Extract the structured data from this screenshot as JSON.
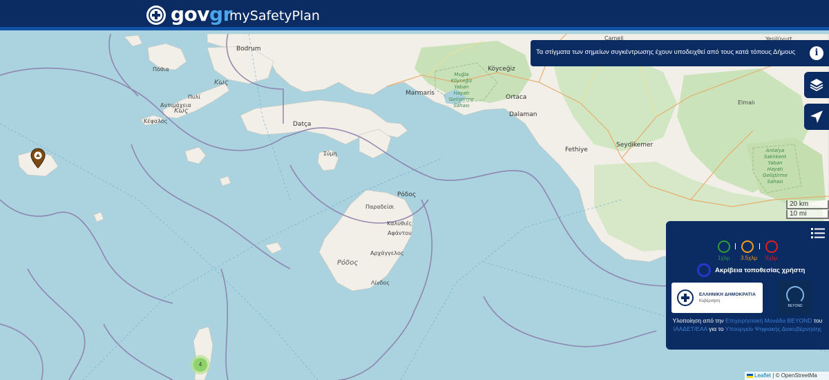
{
  "header": {
    "logo_gov": "gov",
    "logo_gr": "gr",
    "app_title": "mySafetyPlan"
  },
  "info_banner": {
    "text": "Τα στίγματα των σημείων συγκέντρωσης έχουν υποδειχθεί από τους κατά τόπους Δήμους",
    "icon": "info-icon"
  },
  "controls": {
    "layers_icon": "layers-icon",
    "locate_icon": "navigation-arrow-icon",
    "legend_toggle_icon": "list-icon"
  },
  "scale": {
    "km": "20 km",
    "mi": "10 mi"
  },
  "legend": {
    "radii": [
      {
        "label": "1χλμ",
        "color": "#2e9a3c"
      },
      {
        "label": "3.5χλμ",
        "color": "#f0a020"
      },
      {
        "label": "5χλμ",
        "color": "#e02020"
      }
    ],
    "accuracy_label": "Ακρίβεια τοποθεσίας χρήστη",
    "accuracy_color": "#2a35c9",
    "gov_card_title": "ΕΛΛΗΝΙΚΗ ΔΗΜΟΚΡΑΤΙΑ",
    "gov_card_subtitle": "Κυβέρνηση",
    "beyond_label": "BEYOND",
    "credit_prefix": "Υλοποίηση από την",
    "credit_link1": "Επιχειρησιακή Μονάδα BEYOND",
    "credit_mid1": "του",
    "credit_link2": "IAAΔET/EAA",
    "credit_mid2": "για το",
    "credit_link3": "Υπουργείο Ψηφιακής Διακυβέρνησης"
  },
  "attribution": {
    "leaflet": "Leaflet",
    "sep": "|",
    "osm": "© OpenStreetMa"
  },
  "markers": {
    "cluster_count": "4",
    "pin_icon": "map-pin-icon"
  },
  "places": {
    "bodrum": "Bodrum",
    "pothia": "Πόθια",
    "kos_gr": "Κως",
    "pyli": "Πυλί",
    "antimacheia": "Αντιμάχεια",
    "kos_island": "Κως",
    "kefalos": "Κέφαλος",
    "datca": "Datça",
    "symi": "Σύμη",
    "rodos": "Ρόδος",
    "paradeisi": "Παραδείσι",
    "kalythies": "Καλυθιές",
    "afantou": "Αφάντου",
    "archangelos": "Αρχάγγελος",
    "rodos_island": "Ρόδος",
    "lindos": "Λίνδος",
    "marmaris": "Marmaris",
    "koycegiz": "Köyceğiz",
    "ortaca": "Ortaca",
    "dalaman": "Dalaman",
    "fethiye": "Fethiye",
    "seydikemer": "Seydikemer",
    "elmali": "Elmalı",
    "camelli": "Çameli",
    "yesiluyurt": "Yeşilüyurt",
    "mugla_park": "Muğla Köyceğiz Yaban Hayatı Geliştirme Sahası",
    "antalya_park": "Antalya Saklıkent Yaban Hayatı Geliştirme Sahası"
  }
}
